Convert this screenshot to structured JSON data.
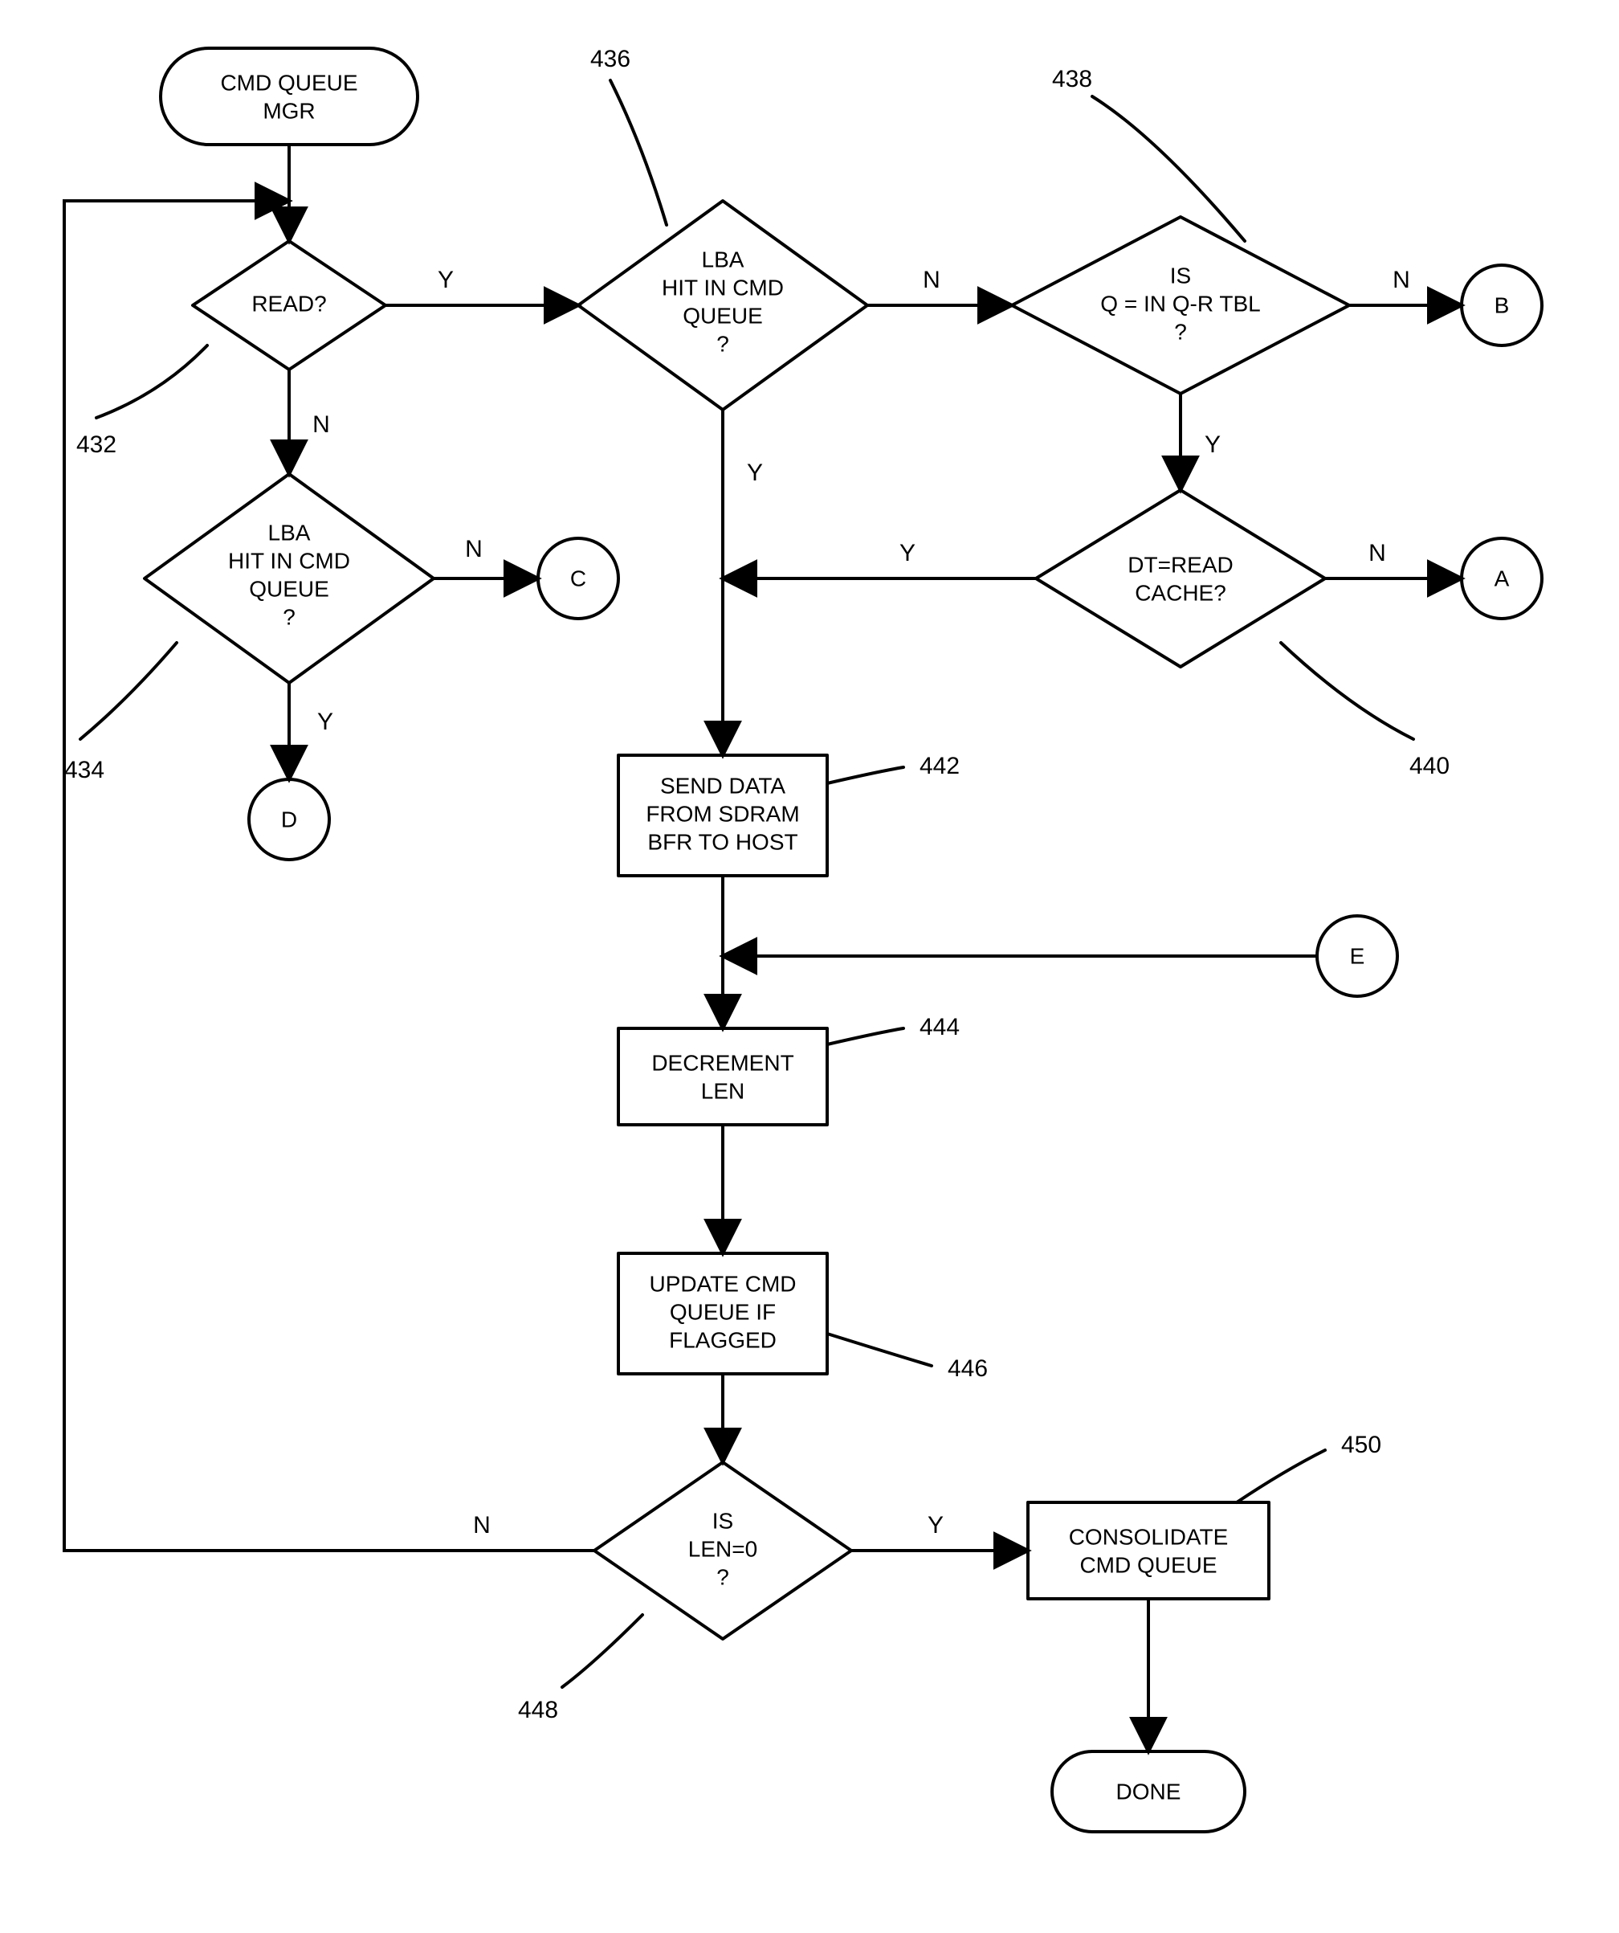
{
  "chart_data": {
    "type": "flowchart",
    "title": "CMD QUEUE MGR",
    "nodes": [
      {
        "id": "start",
        "shape": "terminator",
        "label": "CMD QUEUE MGR"
      },
      {
        "id": "d432",
        "shape": "decision",
        "label": "READ?",
        "ref": "432"
      },
      {
        "id": "d434",
        "shape": "decision",
        "label": "LBA HIT IN CMD QUEUE ?",
        "ref": "434"
      },
      {
        "id": "d436",
        "shape": "decision",
        "label": "LBA HIT IN CMD QUEUE ?",
        "ref": "436"
      },
      {
        "id": "d438",
        "shape": "decision",
        "label": "IS Q = IN Q-R TBL ?",
        "ref": "438"
      },
      {
        "id": "d440",
        "shape": "decision",
        "label": "DT=READ CACHE?",
        "ref": "440"
      },
      {
        "id": "p442",
        "shape": "process",
        "label": "SEND DATA FROM SDRAM BFR TO HOST",
        "ref": "442"
      },
      {
        "id": "p444",
        "shape": "process",
        "label": "DECREMENT LEN",
        "ref": "444"
      },
      {
        "id": "p446",
        "shape": "process",
        "label": "UPDATE CMD QUEUE IF FLAGGED",
        "ref": "446"
      },
      {
        "id": "d448",
        "shape": "decision",
        "label": "IS LEN=0 ?",
        "ref": "448"
      },
      {
        "id": "p450",
        "shape": "process",
        "label": "CONSOLIDATE CMD QUEUE",
        "ref": "450"
      },
      {
        "id": "done",
        "shape": "terminator",
        "label": "DONE"
      },
      {
        "id": "connA",
        "shape": "connector",
        "label": "A"
      },
      {
        "id": "connB",
        "shape": "connector",
        "label": "B"
      },
      {
        "id": "connC",
        "shape": "connector",
        "label": "C"
      },
      {
        "id": "connD",
        "shape": "connector",
        "label": "D"
      },
      {
        "id": "connE",
        "shape": "connector",
        "label": "E"
      }
    ],
    "edges": [
      {
        "from": "start",
        "to": "d432",
        "label": ""
      },
      {
        "from": "d432",
        "to": "d436",
        "label": "Y"
      },
      {
        "from": "d432",
        "to": "d434",
        "label": "N"
      },
      {
        "from": "d434",
        "to": "connC",
        "label": "N"
      },
      {
        "from": "d434",
        "to": "connD",
        "label": "Y"
      },
      {
        "from": "d436",
        "to": "d438",
        "label": "N"
      },
      {
        "from": "d436",
        "to": "p442",
        "label": "Y"
      },
      {
        "from": "d438",
        "to": "connB",
        "label": "N"
      },
      {
        "from": "d438",
        "to": "d440",
        "label": "Y"
      },
      {
        "from": "d440",
        "to": "connA",
        "label": "N"
      },
      {
        "from": "d440",
        "to": "p442",
        "label": "Y"
      },
      {
        "from": "p442",
        "to": "p444",
        "label": ""
      },
      {
        "from": "connE",
        "to": "p444",
        "label": ""
      },
      {
        "from": "p444",
        "to": "p446",
        "label": ""
      },
      {
        "from": "p446",
        "to": "d448",
        "label": ""
      },
      {
        "from": "d448",
        "to": "p450",
        "label": "Y"
      },
      {
        "from": "d448",
        "to": "d432",
        "label": "N"
      },
      {
        "from": "p450",
        "to": "done",
        "label": ""
      }
    ]
  },
  "labels": {
    "Y": "Y",
    "N": "N"
  },
  "refs": {
    "r432": "432",
    "r434": "434",
    "r436": "436",
    "r438": "438",
    "r440": "440",
    "r442": "442",
    "r444": "444",
    "r446": "446",
    "r448": "448",
    "r450": "450"
  },
  "nodeText": {
    "start": {
      "l1": "CMD QUEUE",
      "l2": "MGR"
    },
    "d432": {
      "l1": "READ?"
    },
    "d434": {
      "l1": "LBA",
      "l2": "HIT IN CMD",
      "l3": "QUEUE",
      "l4": "?"
    },
    "d436": {
      "l1": "LBA",
      "l2": "HIT IN CMD",
      "l3": "QUEUE",
      "l4": "?"
    },
    "d438": {
      "l1": "IS",
      "l2": "Q = IN Q-R TBL",
      "l3": "?"
    },
    "d440": {
      "l1": "DT=READ",
      "l2": "CACHE?"
    },
    "p442": {
      "l1": "SEND DATA",
      "l2": "FROM SDRAM",
      "l3": "BFR TO HOST"
    },
    "p444": {
      "l1": "DECREMENT",
      "l2": "LEN"
    },
    "p446": {
      "l1": "UPDATE CMD",
      "l2": "QUEUE IF",
      "l3": "FLAGGED"
    },
    "d448": {
      "l1": "IS",
      "l2": "LEN=0",
      "l3": "?"
    },
    "p450": {
      "l1": "CONSOLIDATE",
      "l2": "CMD QUEUE"
    },
    "done": {
      "l1": "DONE"
    },
    "connA": {
      "l1": "A"
    },
    "connB": {
      "l1": "B"
    },
    "connC": {
      "l1": "C"
    },
    "connD": {
      "l1": "D"
    },
    "connE": {
      "l1": "E"
    }
  }
}
